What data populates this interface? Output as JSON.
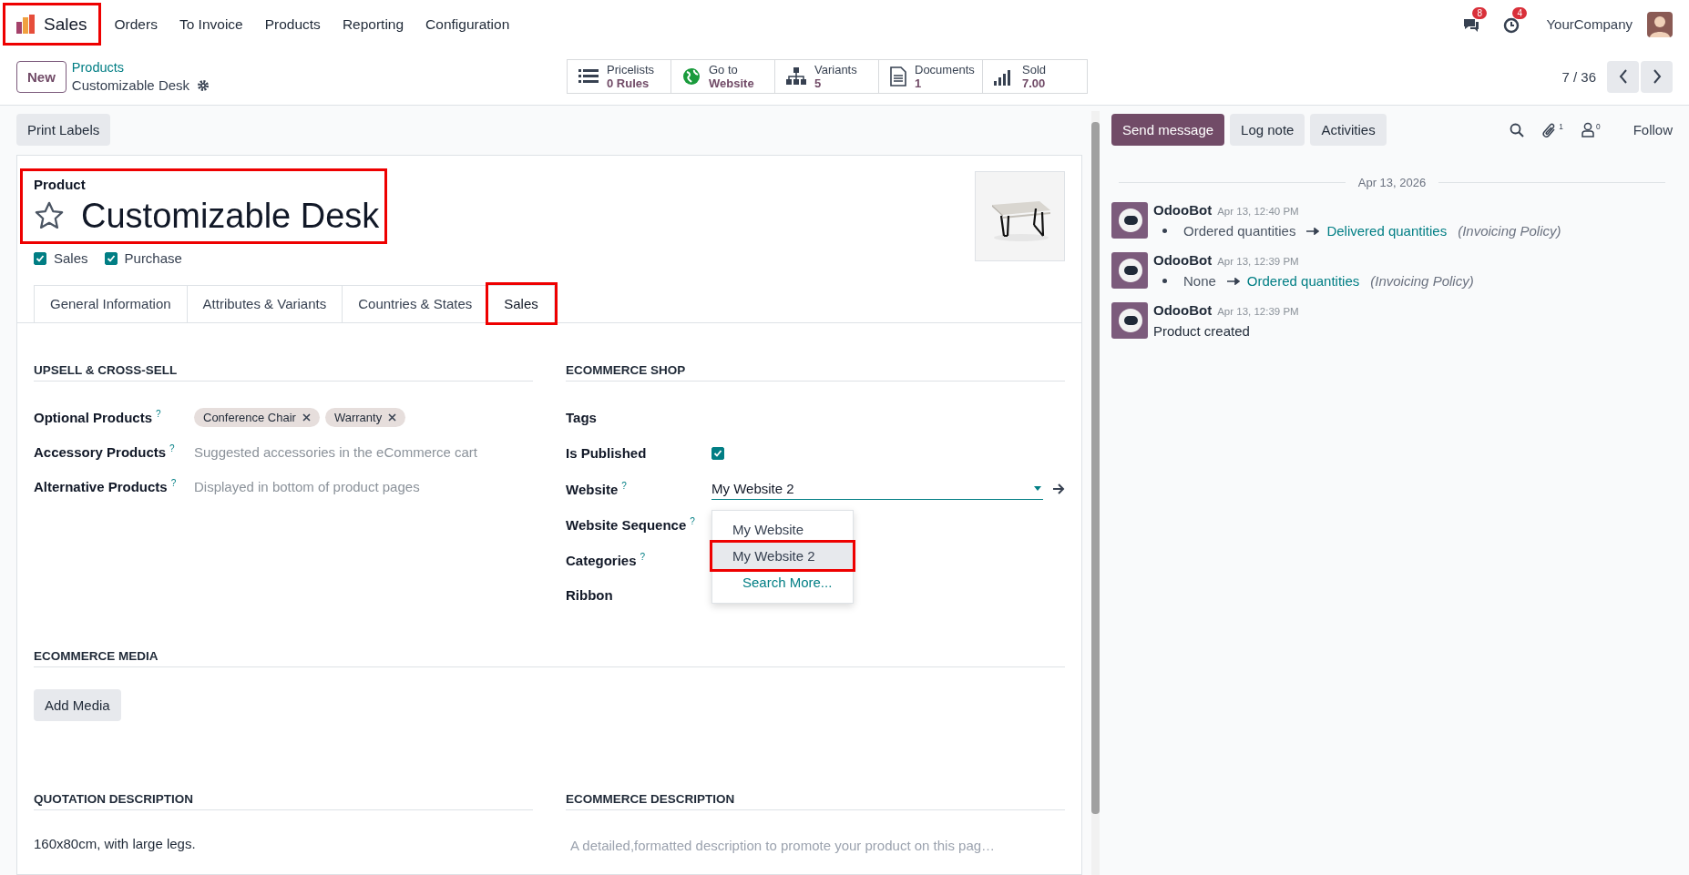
{
  "navbar": {
    "app": {
      "name": "Sales",
      "highlighted": true
    },
    "menu": [
      "Orders",
      "To Invoice",
      "Products",
      "Reporting",
      "Configuration"
    ],
    "messages_badge": "8",
    "activities_badge": "4",
    "company": "YourCompany"
  },
  "control_panel": {
    "new_button": "New",
    "breadcrumb": "Products",
    "record": "Customizable Desk",
    "stats": [
      {
        "kind": "list",
        "label": "Pricelists",
        "value": "0 Rules"
      },
      {
        "kind": "globe",
        "label": "Go to",
        "value": "Website"
      },
      {
        "kind": "tree",
        "label": "Variants",
        "value": "5"
      },
      {
        "kind": "document",
        "label": "Documents",
        "value": "1"
      },
      {
        "kind": "bars",
        "label": "Sold",
        "value": "7.00"
      }
    ],
    "pager": "7 / 36"
  },
  "print_labels": "Print Labels",
  "product": {
    "caption": "Product",
    "name": "Customizable Desk",
    "favorite": false,
    "highlighted": true,
    "flags": [
      {
        "label": "Sales",
        "checked": true
      },
      {
        "label": "Purchase",
        "checked": true
      }
    ]
  },
  "tabs": [
    {
      "label": "General Information",
      "selected": false,
      "highlighted": false
    },
    {
      "label": "Attributes & Variants",
      "selected": false,
      "highlighted": false
    },
    {
      "label": "Countries & States",
      "selected": false,
      "highlighted": false
    },
    {
      "label": "Sales",
      "selected": true,
      "highlighted": true
    }
  ],
  "upsell": {
    "title": "UPSELL & CROSS-SELL",
    "fields": [
      {
        "label": "Optional Products",
        "help": "?",
        "tags": [
          "Conference Chair",
          "Warranty"
        ]
      },
      {
        "label": "Accessory Products",
        "help": "?",
        "placeholder": "Suggested accessories in the eCommerce cart"
      },
      {
        "label": "Alternative Products",
        "help": "?",
        "placeholder": "Displayed in bottom of product pages"
      }
    ]
  },
  "ecommerce_shop": {
    "title": "ECOMMERCE SHOP",
    "fields": [
      {
        "kind": "text",
        "label": "Tags"
      },
      {
        "kind": "checkbox",
        "label": "Is Published",
        "checked": true
      },
      {
        "kind": "select",
        "label": "Website",
        "help": "?",
        "value": "My Website 2"
      },
      {
        "kind": "text",
        "label": "Website Sequence",
        "help": "?"
      },
      {
        "kind": "text",
        "label": "Categories",
        "help": "?"
      },
      {
        "kind": "text",
        "label": "Ribbon"
      }
    ]
  },
  "website_dropdown": {
    "options": [
      {
        "label": "My Website",
        "selected": false,
        "highlighted": false
      },
      {
        "label": "My Website 2",
        "selected": true,
        "highlighted": true
      }
    ],
    "search_more": "Search More..."
  },
  "ecommerce_media": {
    "title": "ECOMMERCE MEDIA",
    "button": "Add Media"
  },
  "quotation_description": {
    "title": "QUOTATION DESCRIPTION",
    "text": "160x80cm, with large legs."
  },
  "ecommerce_description": {
    "title": "ECOMMERCE DESCRIPTION",
    "placeholder": "A detailed,formatted description to promote your product on this pag…"
  },
  "chatter": {
    "buttons": [
      {
        "label": "Send message",
        "selected": true
      },
      {
        "label": "Log note",
        "selected": false
      },
      {
        "label": "Activities",
        "selected": false
      }
    ],
    "attachments_count": "1",
    "followers_count": "0",
    "follow": "Follow",
    "date": "Apr 13, 2026",
    "messages": [
      {
        "author": "OdooBot",
        "time": "Apr 13, 12:40 PM",
        "kind": "change",
        "old": "Ordered quantities",
        "new": "Delivered quantities",
        "field": "(Invoicing Policy)"
      },
      {
        "author": "OdooBot",
        "time": "Apr 13, 12:39 PM",
        "kind": "change",
        "old": "None",
        "new": "Ordered quantities",
        "field": "(Invoicing Policy)"
      },
      {
        "author": "OdooBot",
        "time": "Apr 13, 12:39 PM",
        "kind": "text",
        "body": "Product created"
      }
    ]
  }
}
